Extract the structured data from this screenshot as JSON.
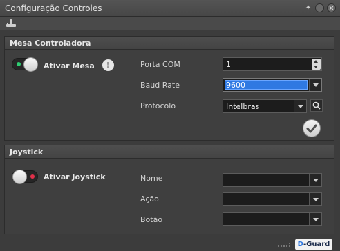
{
  "window": {
    "title": "Configuração Controles",
    "pin_glyph": "✦"
  },
  "mesa": {
    "heading": "Mesa Controladora",
    "toggle_label": "Ativar Mesa",
    "enabled": true,
    "info_glyph": "!",
    "fields": {
      "porta_label": "Porta COM",
      "porta_value": "1",
      "baud_label": "Baud Rate",
      "baud_value": "9600",
      "protocolo_label": "Protocolo",
      "protocolo_value": "Intelbras"
    }
  },
  "joystick": {
    "heading": "Joystick",
    "toggle_label": "Ativar Joystick",
    "enabled": false,
    "fields": {
      "nome_label": "Nome",
      "nome_value": "",
      "acao_label": "Ação",
      "acao_value": "",
      "botao_label": "Botão",
      "botao_value": ""
    }
  },
  "brand": {
    "prefix": "D",
    "rest": "-Guard"
  },
  "colors": {
    "accent": "#2f79e2",
    "toggle_on": "#2ecc71",
    "toggle_off": "#e0304a"
  }
}
